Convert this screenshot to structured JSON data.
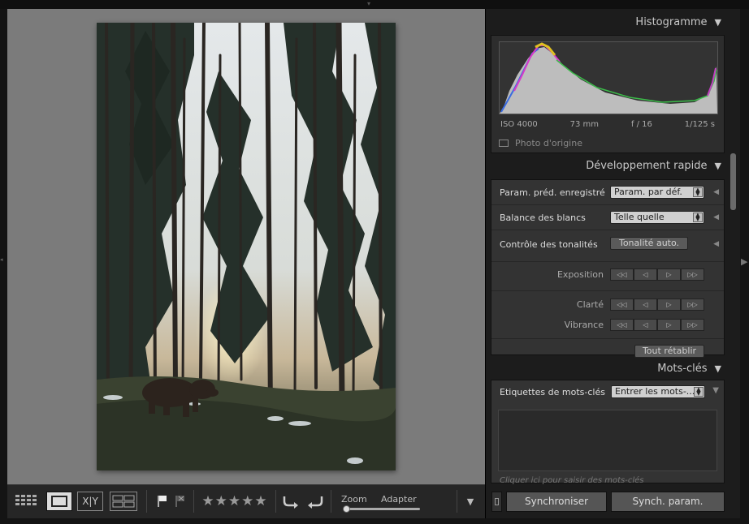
{
  "histogram": {
    "title": "Histogramme",
    "iso": "ISO 4000",
    "focal": "73 mm",
    "aperture": "f / 16",
    "shutter": "1/125 s",
    "original_label": "Photo d'origine"
  },
  "quick_develop": {
    "title": "Développement rapide",
    "preset_label": "Param. préd. enregistré",
    "preset_value": "Param. par déf.",
    "wb_label": "Balance des blancs",
    "wb_value": "Telle quelle",
    "tone_label": "Contrôle des tonalités",
    "auto_tone": "Tonalité auto.",
    "exposure_label": "Exposition",
    "clarity_label": "Clarté",
    "vibrance_label": "Vibrance",
    "reset_all": "Tout rétablir",
    "step_icons": [
      "◁◁",
      "◁",
      "▷",
      "▷▷"
    ]
  },
  "keywords": {
    "title": "Mots-clés",
    "tags_label": "Etiquettes de mots-clés",
    "tags_value": "Entrer les mots-...",
    "hint": "Cliquer ici pour saisir des mots-clés"
  },
  "sync": {
    "sync_label": "Synchroniser",
    "sync_settings_label": "Synch. param."
  },
  "toolbar": {
    "zoom_label": "Zoom",
    "zoom_value": "Adapter",
    "zoom_level": 0.0,
    "rating_stars": "★★★★★",
    "xy_label": "X|Y"
  },
  "colors": {
    "background_center": "#7b7b7b",
    "panel_bg": "#333333",
    "panel_dark": "#1c1c1c"
  }
}
